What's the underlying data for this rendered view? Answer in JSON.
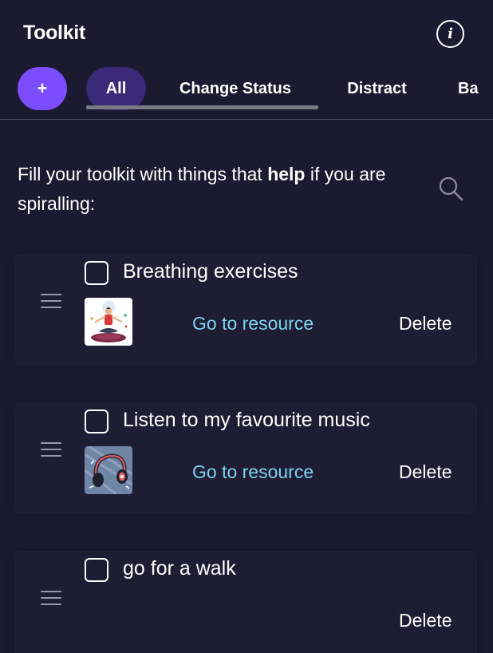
{
  "header": {
    "title": "Toolkit",
    "info_icon": "info-icon",
    "info_glyph": "i"
  },
  "tabs": {
    "add_label": "+",
    "items": [
      {
        "label": "All",
        "selected": true
      },
      {
        "label": "Change Status",
        "selected": false
      },
      {
        "label": "Distract",
        "selected": false
      },
      {
        "label": "Ba",
        "selected": false
      }
    ]
  },
  "intro": {
    "prefix": "Fill your toolkit with things that ",
    "emphasis": "help",
    "suffix": " if you are spiralling:"
  },
  "items": [
    {
      "title": "Breathing exercises",
      "checked": false,
      "link_label": "Go to resource",
      "delete_label": "Delete",
      "thumbnail": "meditation-image"
    },
    {
      "title": "Listen to my favourite music",
      "checked": false,
      "link_label": "Go to resource",
      "delete_label": "Delete",
      "thumbnail": "headphones-image"
    },
    {
      "title": "go for a walk",
      "checked": false,
      "delete_label": "Delete"
    }
  ],
  "colors": {
    "background": "#1c1a30",
    "accent": "#7c4dff",
    "selected_tab": "#3a2a78",
    "link": "#7dd3ee"
  }
}
